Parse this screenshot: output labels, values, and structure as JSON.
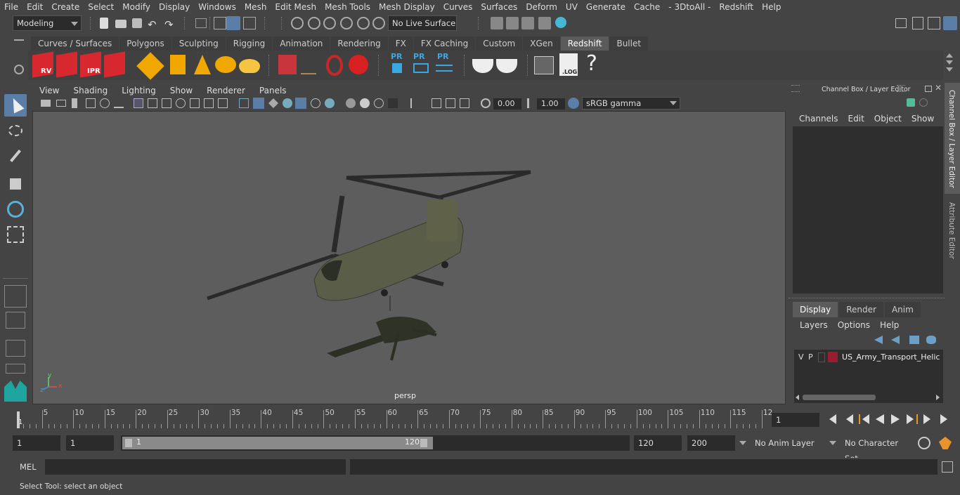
{
  "menubar": [
    "File",
    "Edit",
    "Create",
    "Select",
    "Modify",
    "Display",
    "Windows",
    "Mesh",
    "Edit Mesh",
    "Mesh Tools",
    "Mesh Display",
    "Curves",
    "Surfaces",
    "Deform",
    "UV",
    "Generate",
    "Cache",
    "- 3DtoAll -",
    "Redshift",
    "Help"
  ],
  "statusline": {
    "mode": "Modeling",
    "live_surface": "No Live Surface"
  },
  "shelf": {
    "tabs": [
      "Curves / Surfaces",
      "Polygons",
      "Sculpting",
      "Rigging",
      "Animation",
      "Rendering",
      "FX",
      "FX Caching",
      "Custom",
      "XGen",
      "Redshift",
      "Bullet"
    ],
    "active_tab": "Redshift",
    "icons": {
      "rv": "RV",
      "ipr": "IPR",
      "pr1": "PR",
      "pr2": "PR",
      "pr3": "PR",
      "log": ".LOG",
      "help": "?"
    }
  },
  "viewport": {
    "menu": [
      "View",
      "Shading",
      "Lighting",
      "Show",
      "Renderer",
      "Panels"
    ],
    "exposure": "0.00",
    "gamma": "1.00",
    "colorspace": "sRGB gamma",
    "camera_label": "persp"
  },
  "channelbox": {
    "title": "Channel Box / Layer Editor",
    "menu": [
      "Channels",
      "Edit",
      "Object",
      "Show"
    ],
    "layer_tabs": [
      "Display",
      "Render",
      "Anim"
    ],
    "active_layer_tab": "Display",
    "layer_menu": [
      "Layers",
      "Options",
      "Help"
    ],
    "layers": [
      {
        "v": "V",
        "p": "P",
        "color": "#9b1b30",
        "name": "US_Army_Transport_Helicopt"
      }
    ]
  },
  "sidetabs": [
    "Channel Box / Layer Editor",
    "Attribute Editor"
  ],
  "timeslider": {
    "ticks": [
      "5",
      "10",
      "15",
      "20",
      "25",
      "30",
      "35",
      "40",
      "45",
      "50",
      "55",
      "60",
      "65",
      "70",
      "75",
      "80",
      "85",
      "90",
      "95",
      "100",
      "105",
      "110",
      "115",
      "12"
    ],
    "current_frame_marker": "1",
    "current_frame": "1"
  },
  "range": {
    "start": "1",
    "playback_start": "1",
    "slider_start": "1",
    "slider_end": "120",
    "playback_end": "120",
    "end": "200",
    "anim_layer": "No Anim Layer",
    "char_set": "No Character Set"
  },
  "cmdline": {
    "label": "MEL"
  },
  "helpline": {
    "text": "Select Tool: select an object"
  },
  "axis": {
    "x": "x",
    "y": "y",
    "z": "z"
  }
}
